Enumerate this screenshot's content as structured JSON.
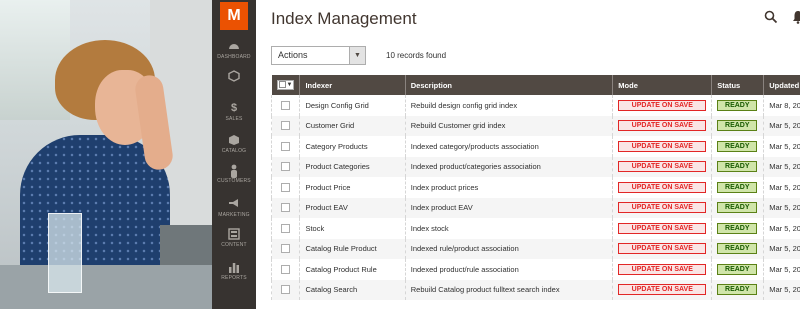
{
  "sidebar": {
    "logo_letter": "M",
    "items": [
      {
        "label": "DASHBOARD",
        "icon": "dashboard-icon"
      },
      {
        "label": "",
        "icon": "hexagon-icon"
      },
      {
        "label": "SALES",
        "icon": "dollar-icon"
      },
      {
        "label": "CATALOG",
        "icon": "cube-icon"
      },
      {
        "label": "CUSTOMERS",
        "icon": "person-icon"
      },
      {
        "label": "MARKETING",
        "icon": "megaphone-icon"
      },
      {
        "label": "CONTENT",
        "icon": "content-icon"
      },
      {
        "label": "REPORTS",
        "icon": "bar-chart-icon"
      }
    ]
  },
  "header": {
    "title": "Index Management"
  },
  "toolbar": {
    "actions_label": "Actions",
    "records_found": "10 records found"
  },
  "grid": {
    "columns": [
      "Indexer",
      "Description",
      "Mode",
      "Status",
      "Updated"
    ],
    "rows": [
      {
        "indexer": "Design Config Grid",
        "description": "Rebuild design config grid index",
        "mode": "UPDATE ON SAVE",
        "status": "READY",
        "updated": "Mar 8, 20"
      },
      {
        "indexer": "Customer Grid",
        "description": "Rebuild Customer grid index",
        "mode": "UPDATE ON SAVE",
        "status": "READY",
        "updated": "Mar 5, 20"
      },
      {
        "indexer": "Category Products",
        "description": "Indexed category/products association",
        "mode": "UPDATE ON SAVE",
        "status": "READY",
        "updated": "Mar 5, 20"
      },
      {
        "indexer": "Product Categories",
        "description": "Indexed product/categories association",
        "mode": "UPDATE ON SAVE",
        "status": "READY",
        "updated": "Mar 5, 20"
      },
      {
        "indexer": "Product Price",
        "description": "Index product prices",
        "mode": "UPDATE ON SAVE",
        "status": "READY",
        "updated": "Mar 5, 20"
      },
      {
        "indexer": "Product EAV",
        "description": "Index product EAV",
        "mode": "UPDATE ON SAVE",
        "status": "READY",
        "updated": "Mar 5, 20"
      },
      {
        "indexer": "Stock",
        "description": "Index stock",
        "mode": "UPDATE ON SAVE",
        "status": "READY",
        "updated": "Mar 5, 20"
      },
      {
        "indexer": "Catalog Rule Product",
        "description": "Indexed rule/product association",
        "mode": "UPDATE ON SAVE",
        "status": "READY",
        "updated": "Mar 5, 20"
      },
      {
        "indexer": "Catalog Product Rule",
        "description": "Indexed product/rule association",
        "mode": "UPDATE ON SAVE",
        "status": "READY",
        "updated": "Mar 5, 20"
      },
      {
        "indexer": "Catalog Search",
        "description": "Rebuild Catalog product fulltext search index",
        "mode": "UPDATE ON SAVE",
        "status": "READY",
        "updated": "Mar 5, 20"
      }
    ]
  },
  "colors": {
    "brand_orange": "#eb5202",
    "sidebar_bg": "#373330",
    "header_bg": "#514943",
    "mode_red": "#e22626",
    "status_green": "#185b00"
  }
}
